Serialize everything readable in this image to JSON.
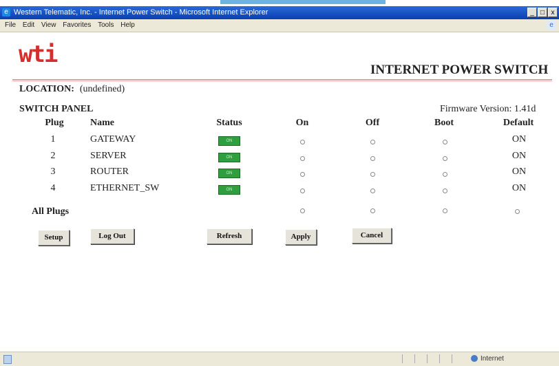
{
  "window": {
    "title": "Western Telematic, Inc. - Internet Power Switch - Microsoft Internet Explorer",
    "controls": [
      "_",
      "□",
      "x"
    ]
  },
  "menu": [
    "File",
    "Edit",
    "View",
    "Favorites",
    "Tools",
    "Help"
  ],
  "header": {
    "logo": "wti",
    "product": "INTERNET POWER SWITCH"
  },
  "location": {
    "label": "LOCATION:",
    "value": "(undefined)"
  },
  "panel": {
    "title": "SWITCH PANEL",
    "firmware": "Firmware Version: 1.41d",
    "columns": [
      "Plug",
      "Name",
      "Status",
      "On",
      "Off",
      "Boot",
      "Default"
    ],
    "rows": [
      {
        "plug": "1",
        "name": "GATEWAY",
        "status": "ON",
        "default": "ON"
      },
      {
        "plug": "2",
        "name": "SERVER",
        "status": "ON",
        "default": "ON"
      },
      {
        "plug": "3",
        "name": "ROUTER",
        "status": "ON",
        "default": "ON"
      },
      {
        "plug": "4",
        "name": "ETHERNET_SW",
        "status": "ON",
        "default": "ON"
      }
    ],
    "all_plugs_label": "All Plugs"
  },
  "buttons": {
    "setup": "Setup",
    "logout": "Log Out",
    "refresh": "Refresh",
    "apply": "Apply",
    "cancel": "Cancel"
  },
  "statusbar": {
    "zone": "Internet"
  },
  "colors": {
    "status_on": "#2f9e3f",
    "logo": "#d32f2f",
    "titlebar": "#0a3fb0"
  }
}
